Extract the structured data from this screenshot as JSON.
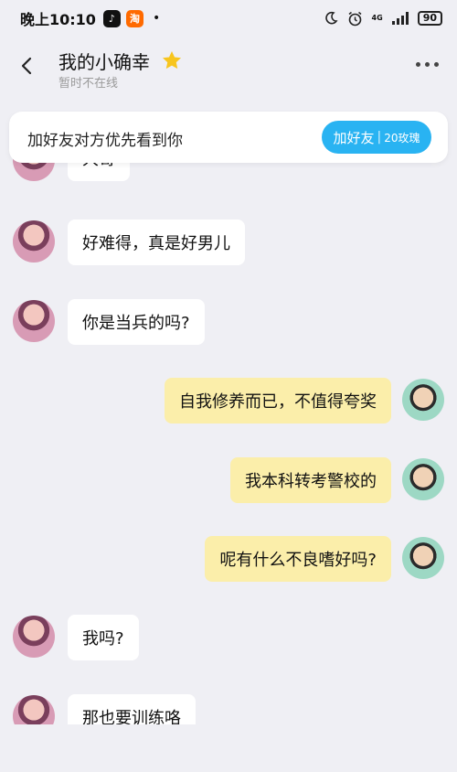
{
  "status_bar": {
    "time": "晚上10:10",
    "dot": "•",
    "network": "4G",
    "battery": "90"
  },
  "header": {
    "title": "我的小确幸",
    "subtitle": "暂时不在线"
  },
  "banner": {
    "text": "加好友对方优先看到你",
    "button_label": "加好友",
    "button_sep": "|",
    "button_sub": "20玫瑰",
    "accent_color": "#29b3f2"
  },
  "messages": [
    {
      "side": "in",
      "text": "大哥"
    },
    {
      "side": "in",
      "text": "好难得，真是好男儿"
    },
    {
      "side": "in",
      "text": "你是当兵的吗?"
    },
    {
      "side": "out",
      "text": "自我修养而已，不值得夸奖"
    },
    {
      "side": "out",
      "text": "我本科转考警校的"
    },
    {
      "side": "out",
      "text": "呢有什么不良嗜好吗?"
    },
    {
      "side": "in",
      "text": "我吗?"
    },
    {
      "side": "in",
      "text": "那也要训练咯"
    }
  ],
  "colors": {
    "background": "#efeff4",
    "incoming_bubble": "#ffffff",
    "outgoing_bubble": "#fbeeaa"
  }
}
